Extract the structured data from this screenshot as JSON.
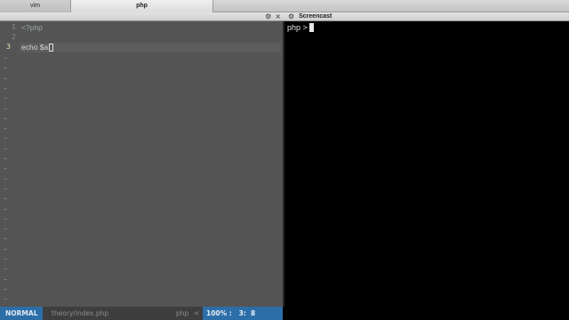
{
  "tabs": [
    {
      "label": "vim"
    },
    {
      "label": "php"
    }
  ],
  "left_pane": {
    "header_icons": [
      "gear-icon",
      "close-icon"
    ]
  },
  "editor": {
    "lines": [
      {
        "number": "1",
        "text": "<?php"
      },
      {
        "number": "2",
        "text": ""
      },
      {
        "number": "3",
        "text": "echo $a"
      }
    ],
    "current_line": 3
  },
  "statusline": {
    "mode": "NORMAL",
    "file_path": "theory/index.php",
    "filetype": "php",
    "fileformat": "<",
    "position": "100% :   3:  8"
  },
  "terminal": {
    "title": "Screencast",
    "prompt": "php > ",
    "header_icons": [
      "gear-icon"
    ]
  },
  "colors": {
    "editor_bg": "#545454",
    "status_accent": "#2c6ea8",
    "terminal_bg": "#000000"
  }
}
